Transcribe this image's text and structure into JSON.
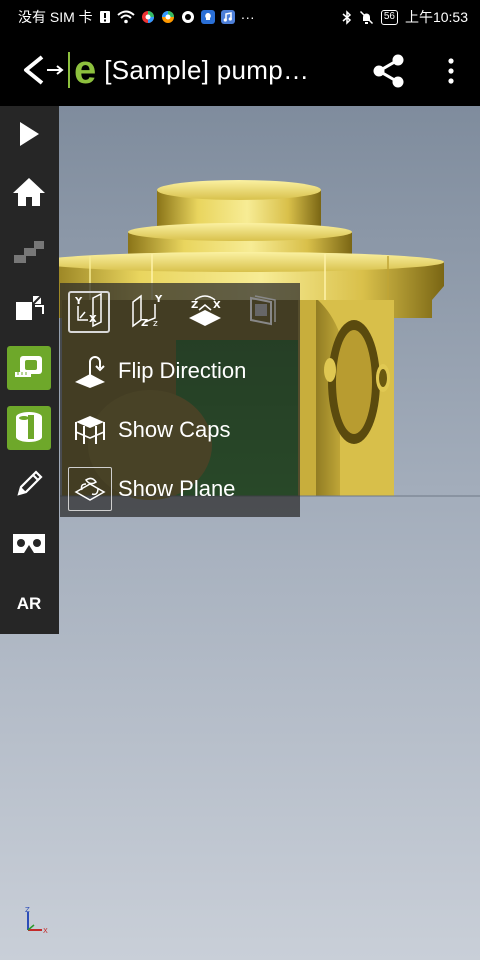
{
  "status_bar": {
    "carrier": "没有 SIM 卡",
    "battery": "56",
    "time": "上午10:53",
    "more": "···"
  },
  "app_bar": {
    "logo": "e",
    "title": "[Sample] pump…"
  },
  "toolbar": {
    "items": [
      {
        "name": "play",
        "active": false
      },
      {
        "name": "home",
        "active": false
      },
      {
        "name": "steps",
        "active": false
      },
      {
        "name": "explode",
        "active": false
      },
      {
        "name": "measure",
        "active": true
      },
      {
        "name": "section",
        "active": true
      },
      {
        "name": "markup",
        "active": false
      },
      {
        "name": "vr",
        "active": false
      },
      {
        "name": "ar",
        "active": false
      }
    ],
    "ar_label": "AR"
  },
  "section_menu": {
    "planes": [
      {
        "axes": "YX",
        "selected": true
      },
      {
        "axes": "YZ",
        "selected": false
      },
      {
        "axes": "ZX",
        "selected": false
      },
      {
        "axes": "custom",
        "selected": false
      }
    ],
    "items": [
      {
        "label": "Flip Direction"
      },
      {
        "label": "Show Caps"
      },
      {
        "label": "Show Plane"
      }
    ]
  },
  "colors": {
    "accent": "#6ea82a",
    "model_gold": "#e6d25a",
    "toolbar_bg": "#262626"
  }
}
